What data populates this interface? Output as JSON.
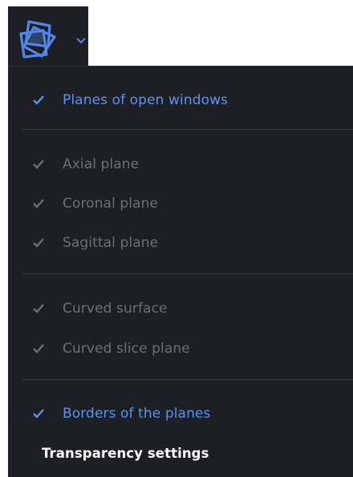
{
  "toolbar": {
    "icon": "planes-icon",
    "dropdown_icon": "chevron-down-icon",
    "accent": "#4f86e8"
  },
  "menu": {
    "groups": [
      {
        "items": [
          {
            "label": "Planes of open windows",
            "checked": true,
            "enabled": true
          }
        ]
      },
      {
        "items": [
          {
            "label": "Axial plane",
            "checked": true,
            "enabled": false
          },
          {
            "label": "Coronal plane",
            "checked": true,
            "enabled": false
          },
          {
            "label": "Sagittal plane",
            "checked": true,
            "enabled": false
          }
        ]
      },
      {
        "items": [
          {
            "label": "Curved surface",
            "checked": true,
            "enabled": false
          },
          {
            "label": "Curved slice plane",
            "checked": true,
            "enabled": false
          }
        ]
      },
      {
        "items": [
          {
            "label": "Borders of the planes",
            "checked": true,
            "enabled": true
          },
          {
            "label": "Transparency settings",
            "checked": false,
            "enabled": true
          }
        ]
      }
    ]
  },
  "colors": {
    "menu_background": "#1d1f24",
    "active_text": "#5a93f0",
    "disabled_text": "#6c6f76",
    "plain_text": "#ffffff",
    "divider": "#3a3d44"
  }
}
